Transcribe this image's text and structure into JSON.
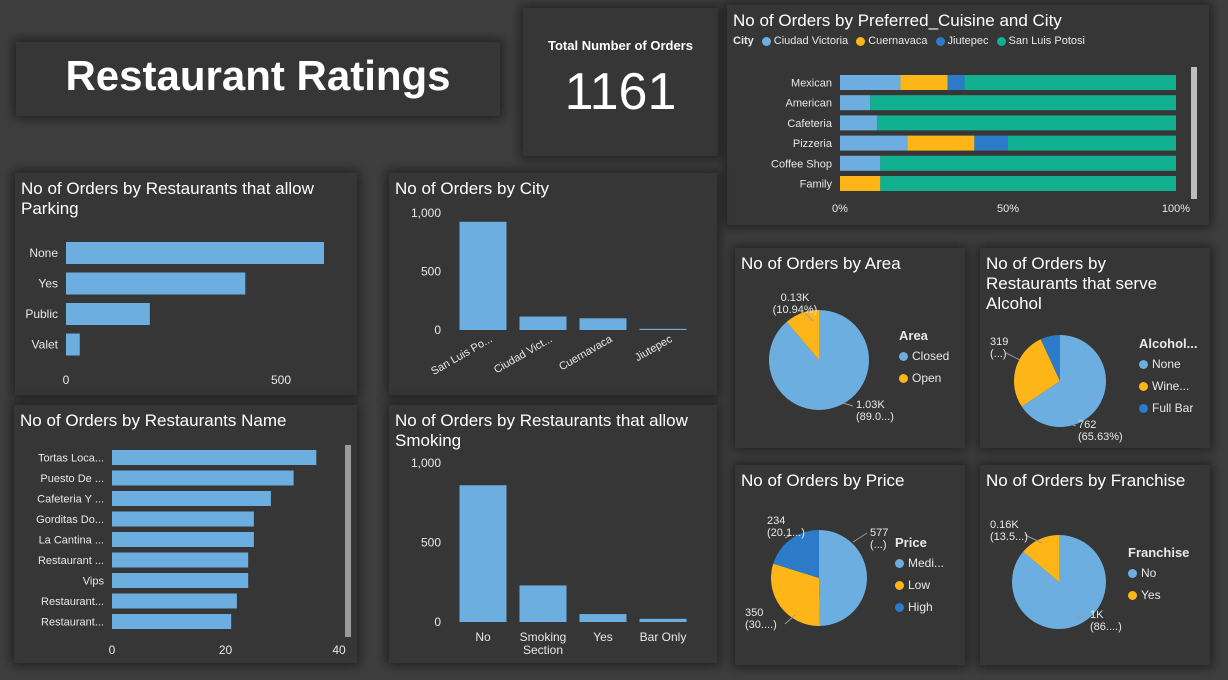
{
  "title": "Restaurant Ratings",
  "kpi": {
    "label": "Total Number of Orders",
    "value": "1161"
  },
  "colors": {
    "blue": "#6CAEE0",
    "yellow": "#FDB517",
    "darkblue": "#2C7BC8",
    "teal": "#11B091",
    "bar": "#6CAEE0"
  },
  "chart_data": [
    {
      "id": "cuisine",
      "type": "bar",
      "orientation": "horizontal",
      "stacked": "percent",
      "title": "No of Orders by Preferred_Cuisine and City",
      "legend_title": "City",
      "categories": [
        "Mexican",
        "American",
        "Cafeteria",
        "Pizzeria",
        "Coffee Shop",
        "Family"
      ],
      "series": [
        {
          "name": "Ciudad Victoria",
          "values": [
            18,
            9,
            11,
            20,
            12,
            0
          ]
        },
        {
          "name": "Cuernavaca",
          "values": [
            14,
            0,
            0,
            20,
            0,
            12
          ]
        },
        {
          "name": "Jiutepec",
          "values": [
            5,
            0,
            0,
            10,
            0,
            0
          ]
        },
        {
          "name": "San Luis Potosi",
          "values": [
            63,
            91,
            89,
            50,
            88,
            88
          ]
        }
      ],
      "xticks": [
        "0%",
        "50%",
        "100%"
      ]
    },
    {
      "id": "parking",
      "type": "bar",
      "orientation": "horizontal",
      "title": "No of Orders by Restaurants that allow Parking",
      "categories": [
        "None",
        "Yes",
        "Public",
        "Valet"
      ],
      "values": [
        600,
        417,
        195,
        32
      ],
      "xlim": [
        0,
        600
      ],
      "xticks": [
        "0",
        "500"
      ]
    },
    {
      "id": "city",
      "type": "bar",
      "orientation": "vertical",
      "title": "No of Orders by City",
      "categories": [
        "San Luis Po...",
        "Ciudad Vict...",
        "Cuernavaca",
        "Jiutepec"
      ],
      "values": [
        925,
        115,
        100,
        10
      ],
      "ylim": [
        0,
        1000
      ],
      "yticks": [
        "0",
        "500",
        "1,000"
      ]
    },
    {
      "id": "names",
      "type": "bar",
      "orientation": "horizontal",
      "title": "No of Orders by Restaurants Name",
      "categories": [
        "Tortas Loca...",
        "Puesto De ...",
        "Cafeteria Y ...",
        "Gorditas Do...",
        "La Cantina ...",
        "Restaurant ...",
        "Vips",
        "Restaurant...",
        "Restaurant..."
      ],
      "values": [
        36,
        32,
        28,
        25,
        25,
        24,
        24,
        22,
        21
      ],
      "xlim": [
        0,
        40
      ],
      "xticks": [
        "0",
        "20",
        "40"
      ]
    },
    {
      "id": "smoking",
      "type": "bar",
      "orientation": "vertical",
      "title": "No of Orders by Restaurants that allow Smoking",
      "categories": [
        "No",
        "Smoking Section",
        "Yes",
        "Bar Only"
      ],
      "values": [
        860,
        230,
        50,
        20
      ],
      "ylim": [
        0,
        1000
      ],
      "yticks": [
        "0",
        "500",
        "1,000"
      ]
    },
    {
      "id": "area",
      "type": "pie",
      "title": "No of Orders by Area",
      "legend_title": "Area",
      "labels": [
        "Closed",
        "Open"
      ],
      "values": [
        1030,
        130
      ],
      "percent": [
        89.06,
        10.94
      ],
      "data_labels": [
        [
          "1.03K",
          "(89.0...)"
        ],
        [
          "0.13K",
          "(10.94%)"
        ]
      ]
    },
    {
      "id": "alcohol",
      "type": "pie",
      "title": "No of Orders by Restaurants that serve Alcohol",
      "legend_title": "Alcohol...",
      "labels": [
        "None",
        "Wine...",
        "Full Bar"
      ],
      "values": [
        762,
        319,
        80
      ],
      "percent": [
        65.63,
        27.48,
        6.89
      ],
      "data_labels": [
        [
          "762",
          "(65.63%)"
        ],
        [
          "319",
          "(...)"
        ],
        [
          "",
          ""
        ]
      ]
    },
    {
      "id": "price",
      "type": "pie",
      "title": "No of Orders by Price",
      "legend_title": "Price",
      "labels": [
        "Medi...",
        "Low",
        "High"
      ],
      "values": [
        577,
        350,
        234
      ],
      "percent": [
        49.7,
        30.15,
        20.15
      ],
      "data_labels": [
        [
          "577",
          "(...)"
        ],
        [
          "350",
          "(30....)"
        ],
        [
          "234",
          "(20.1...)"
        ]
      ]
    },
    {
      "id": "franchise",
      "type": "pie",
      "title": "No of Orders by Franchise",
      "legend_title": "Franchise",
      "labels": [
        "No",
        "Yes"
      ],
      "values": [
        1000,
        160
      ],
      "percent": [
        86.3,
        13.7
      ],
      "data_labels": [
        [
          "1K",
          "(86....)"
        ],
        [
          "0.16K",
          "(13.5...)"
        ]
      ]
    }
  ]
}
